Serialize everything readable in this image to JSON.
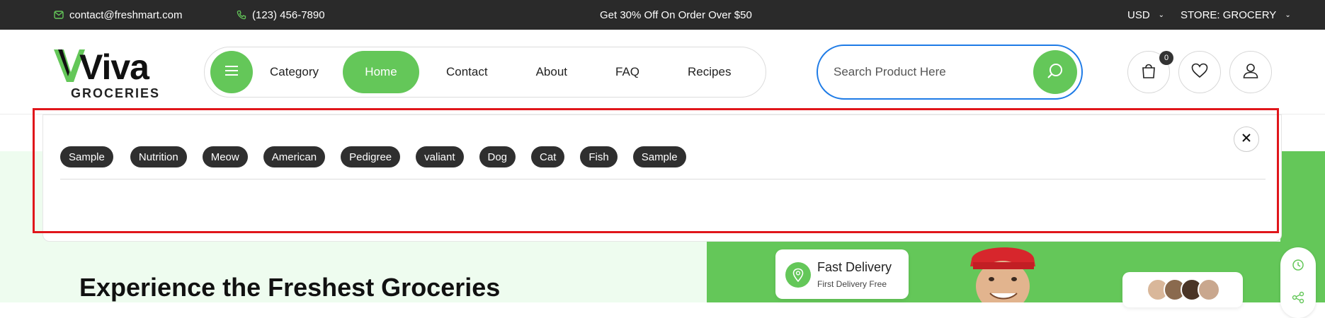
{
  "topbar": {
    "email": "contact@freshmart.com",
    "phone": "(123) 456-7890",
    "promo": "Get 30% Off On Order Over $50",
    "currency": "USD",
    "store": "STORE: GROCERY"
  },
  "logo": {
    "brand": "Viva",
    "sub": "GROCERIES"
  },
  "nav": {
    "category": "Category",
    "home": "Home",
    "contact": "Contact",
    "about": "About",
    "faq": "FAQ",
    "recipes": "Recipes"
  },
  "search": {
    "placeholder": "Search Product Here"
  },
  "cart": {
    "count": "0"
  },
  "dropdown": {
    "tags": [
      "Sample",
      "Nutrition",
      "Meow",
      "American",
      "Pedigree",
      "valiant",
      "Dog",
      "Cat",
      "Fish",
      "Sample"
    ]
  },
  "hero": {
    "title": "Experience the Freshest Groceries",
    "delivery_title": "Fast Delivery",
    "delivery_sub": "First Delivery Free"
  },
  "colors": {
    "accent": "#64c759",
    "topbar": "#2a2a2a",
    "search_border": "#1e7be6",
    "highlight": "#e0161b"
  }
}
